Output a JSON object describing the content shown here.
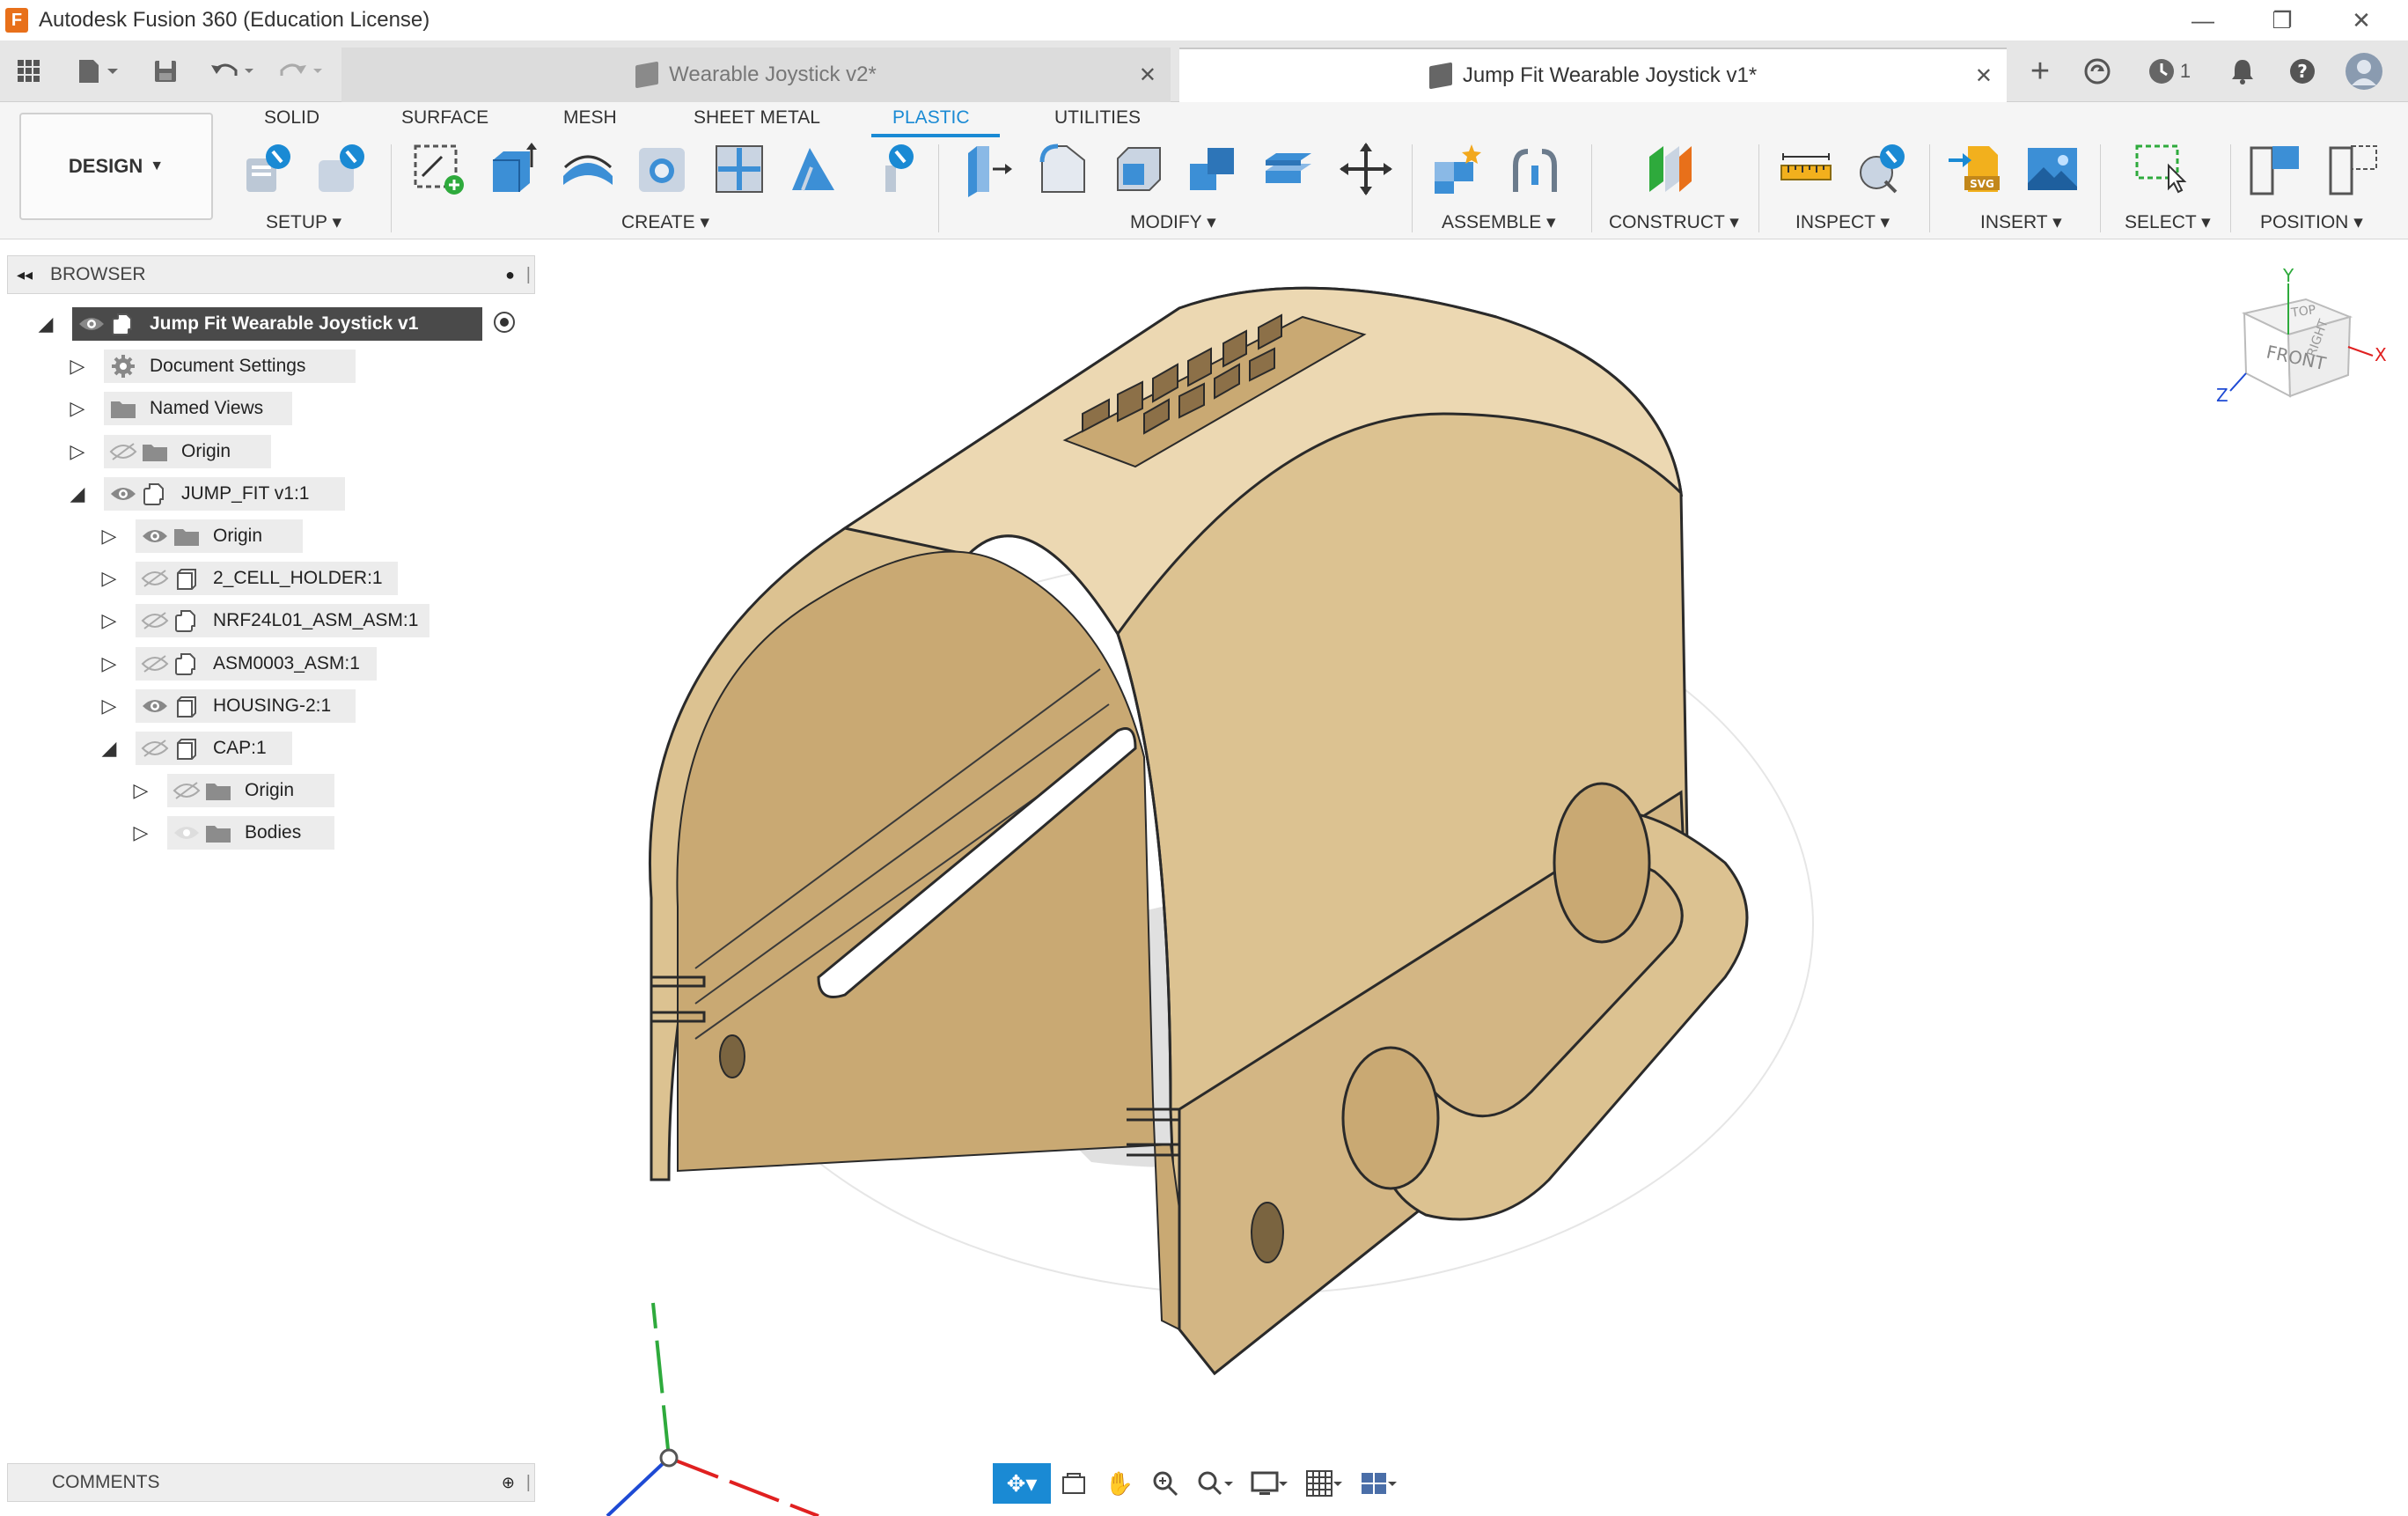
{
  "window": {
    "title": "Autodesk Fusion 360 (Education License)",
    "app_icon_letter": "F"
  },
  "tabs": [
    {
      "label": "Wearable Joystick v2*",
      "active": false
    },
    {
      "label": "Jump Fit Wearable Joystick v1*",
      "active": true
    }
  ],
  "header_right": {
    "job_count": "1"
  },
  "ribbon": {
    "workspace": "DESIGN",
    "workspace_tabs": [
      "SOLID",
      "SURFACE",
      "MESH",
      "SHEET METAL",
      "PLASTIC",
      "UTILITIES"
    ],
    "active_tab": "PLASTIC",
    "groups": [
      "SETUP",
      "CREATE",
      "MODIFY",
      "ASSEMBLE",
      "CONSTRUCT",
      "INSPECT",
      "INSERT",
      "SELECT",
      "POSITION"
    ]
  },
  "browser": {
    "title": "BROWSER",
    "items": [
      {
        "label": "Jump Fit Wearable Joystick v1",
        "level": 0,
        "expanded": true,
        "visible": true,
        "icon": "component-icon",
        "root": true
      },
      {
        "label": "Document Settings",
        "level": 1,
        "expanded": false,
        "visible": null,
        "icon": "gear-icon"
      },
      {
        "label": "Named Views",
        "level": 1,
        "expanded": false,
        "visible": null,
        "icon": "folder-icon"
      },
      {
        "label": "Origin",
        "level": 1,
        "expanded": false,
        "visible": false,
        "icon": "folder-icon"
      },
      {
        "label": "JUMP_FIT v1:1",
        "level": 1,
        "expanded": true,
        "visible": true,
        "icon": "component-icon"
      },
      {
        "label": "Origin",
        "level": 2,
        "expanded": false,
        "visible": true,
        "icon": "folder-icon"
      },
      {
        "label": "2_CELL_HOLDER:1",
        "level": 2,
        "expanded": false,
        "visible": false,
        "icon": "body-icon"
      },
      {
        "label": "NRF24L01_ASM_ASM:1",
        "level": 2,
        "expanded": false,
        "visible": false,
        "icon": "component-icon"
      },
      {
        "label": "ASM0003_ASM:1",
        "level": 2,
        "expanded": false,
        "visible": false,
        "icon": "component-icon"
      },
      {
        "label": "HOUSING-2:1",
        "level": 2,
        "expanded": false,
        "visible": true,
        "icon": "body-icon"
      },
      {
        "label": "CAP:1",
        "level": 2,
        "expanded": true,
        "visible": false,
        "icon": "body-icon"
      },
      {
        "label": "Origin",
        "level": 3,
        "expanded": false,
        "visible": false,
        "icon": "folder-icon"
      },
      {
        "label": "Bodies",
        "level": 3,
        "expanded": false,
        "visible": true,
        "icon": "folder-icon"
      }
    ]
  },
  "comments": {
    "title": "COMMENTS"
  },
  "viewcube": {
    "front": "FRONT",
    "top": "TOP",
    "right": "RIGHT",
    "axis_x": "X",
    "axis_y": "Y",
    "axis_z": "Z"
  },
  "colors": {
    "accent": "#1a8ad4",
    "model": "#dcc291",
    "model_dark": "#b89a68",
    "model_light": "#ecd8b2",
    "shadow": "#cfcfcf"
  }
}
